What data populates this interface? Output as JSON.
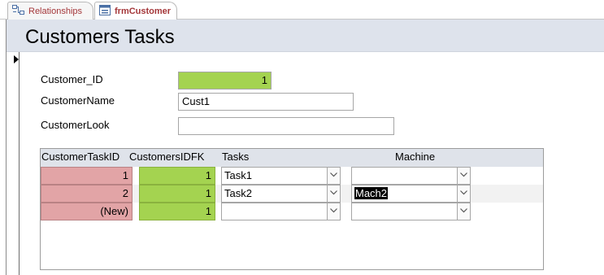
{
  "tabs": [
    {
      "label": "Relationships",
      "icon": "relationships-icon"
    },
    {
      "label": "frmCustomer",
      "icon": "form-icon"
    }
  ],
  "form": {
    "title": "Customers Tasks",
    "fields": {
      "customer_id": {
        "label": "Customer_ID",
        "value": "1"
      },
      "customer_name": {
        "label": "CustomerName",
        "value": "Cust1"
      },
      "customer_look": {
        "label": "CustomerLook",
        "value": ""
      }
    }
  },
  "subform": {
    "columns": [
      "CustomerTaskID",
      "CustomersIDFK",
      "Tasks",
      "Machine"
    ],
    "rows": [
      {
        "task_id": "1",
        "customers_idfk": "1",
        "task": "Task1",
        "machine": ""
      },
      {
        "task_id": "2",
        "customers_idfk": "1",
        "task": "Task2",
        "machine": "Mach2"
      },
      {
        "task_id": "(New)",
        "customers_idfk": "1",
        "task": "",
        "machine": ""
      }
    ]
  },
  "colors": {
    "accent_tab_text": "#a4373a",
    "header_band": "#dee3ec",
    "key_field_green": "#a4d350",
    "autonumber_pink": "#e2a4a6"
  }
}
